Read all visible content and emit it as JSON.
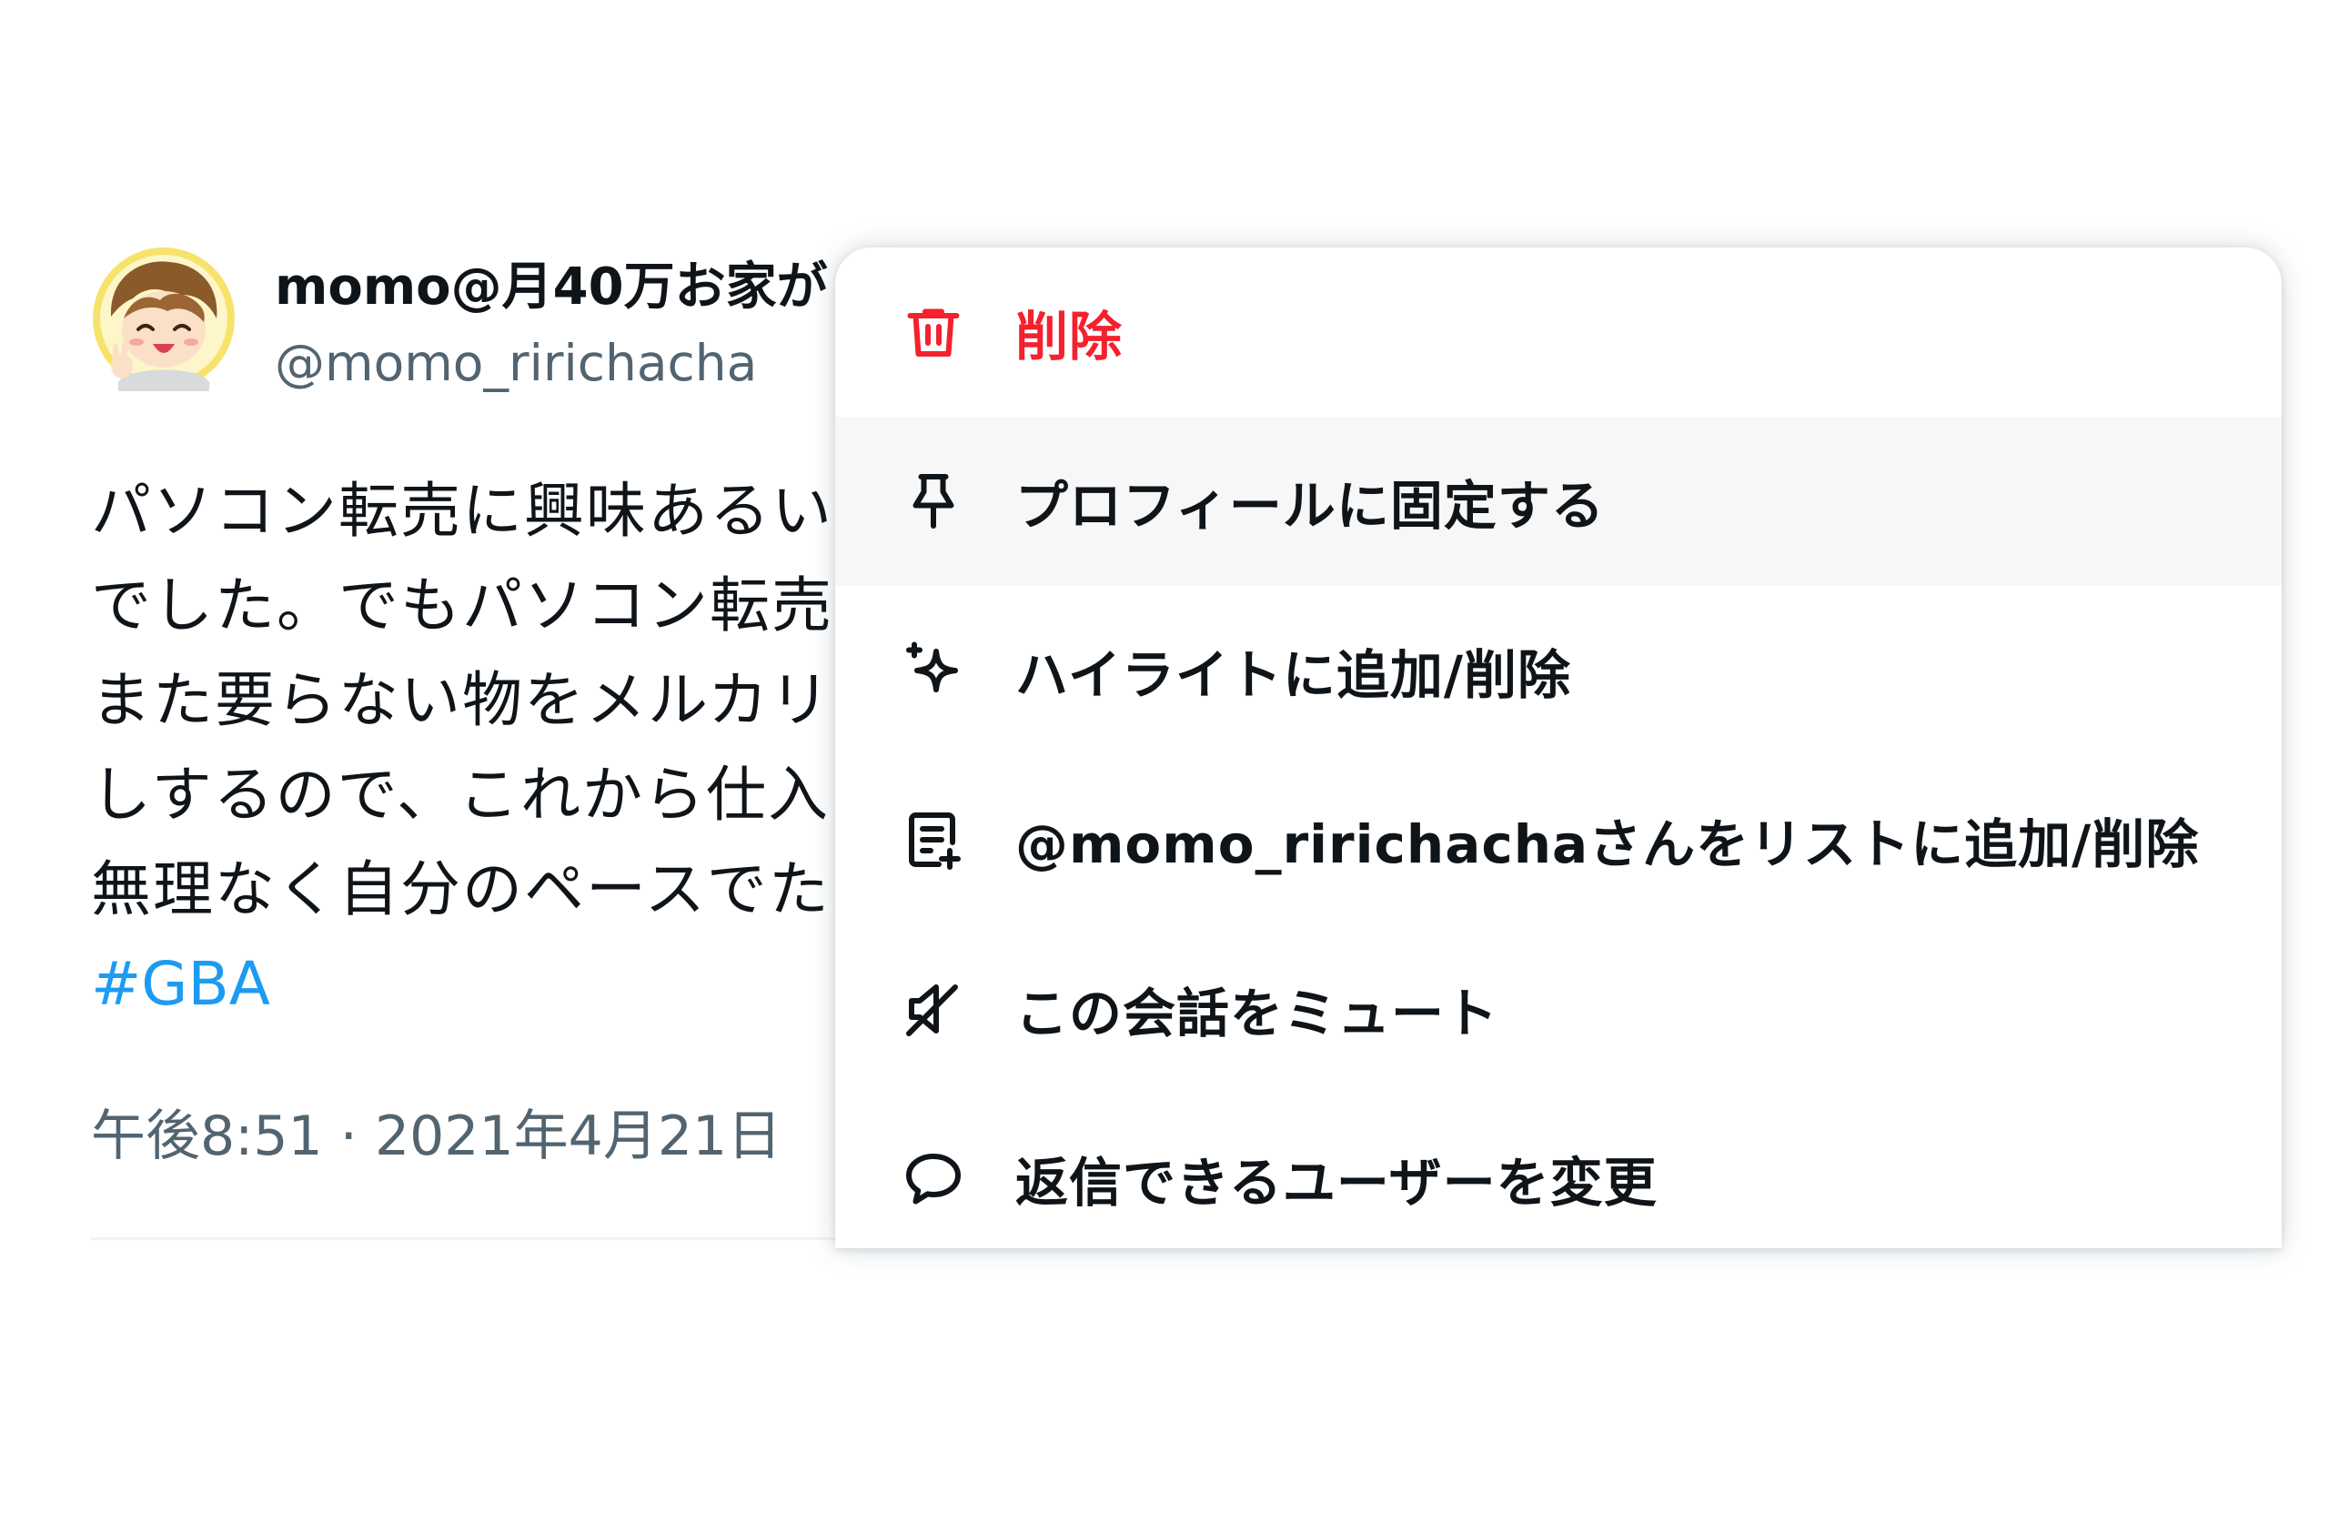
{
  "tweet": {
    "display_name": "momo@月40万お家が",
    "handle": "@momo_ririchacha",
    "body_lines": [
      "パソコン転売に興味あるい",
      "でした。でもパソコン転売",
      "また要らない物をメルカリ",
      "しするので、これから仕入",
      "無理なく自分のペースでた"
    ],
    "hashtag": "#GBA",
    "timestamp": "午後8:51 · 2021年4月21日"
  },
  "menu": {
    "items": [
      {
        "label": "削除",
        "icon": "trash-icon",
        "danger": true
      },
      {
        "label": "プロフィールに固定する",
        "icon": "pin-icon",
        "hovered": true
      },
      {
        "label": "ハイライトに追加/削除",
        "icon": "sparkle-icon"
      },
      {
        "label": "@momo_ririchachaさんをリストに追加/削除",
        "icon": "list-add-icon"
      },
      {
        "label": "この会話をミュート",
        "icon": "mute-icon"
      },
      {
        "label": "返信できるユーザーを変更",
        "icon": "speech-bubble-icon"
      }
    ]
  },
  "colors": {
    "text_primary": "#0f1419",
    "text_secondary": "#536471",
    "link": "#1d9bf0",
    "danger": "#f4212e",
    "hover_bg": "#f7f7f7"
  }
}
